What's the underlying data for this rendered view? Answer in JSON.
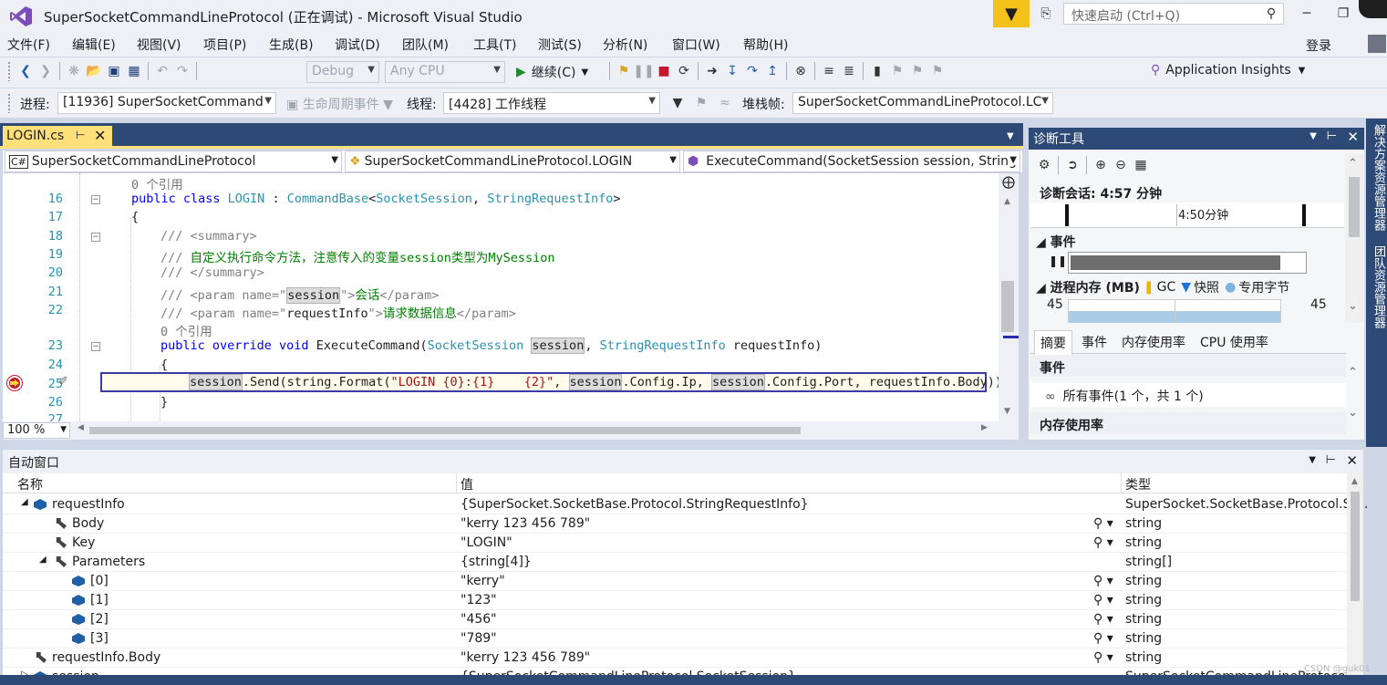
{
  "window": {
    "title": "SuperSocketCommandLineProtocol (正在调试) - Microsoft Visual Studio",
    "quick_launch_placeholder": "快速启动 (Ctrl+Q)",
    "login": "登录"
  },
  "menu": [
    "文件(F)",
    "编辑(E)",
    "视图(V)",
    "项目(P)",
    "生成(B)",
    "调试(D)",
    "团队(M)",
    "工具(T)",
    "测试(S)",
    "分析(N)",
    "窗口(W)",
    "帮助(H)"
  ],
  "toolbar1": {
    "config": "Debug",
    "platform": "Any CPU",
    "continue": "继续(C)",
    "app_insights": "Application Insights"
  },
  "toolbar2": {
    "process_label": "进程:",
    "process": "[11936] SuperSocketCommand",
    "lifecycle": "生命周期事件",
    "thread_label": "线程:",
    "thread": "[4428] 工作线程",
    "stack_label": "堆栈帧:",
    "stack": "SuperSocketCommandLineProtocol.LC"
  },
  "editor": {
    "tab": "LOGIN.cs",
    "nav": [
      "SuperSocketCommandLineProtocol",
      "SuperSocketCommandLineProtocol.LOGIN",
      "ExecuteCommand(SocketSession session, String"
    ],
    "zoom": "100 %",
    "refs1": "0 个引用",
    "refs2": "0 个引用",
    "line_numbers": [
      "16",
      "17",
      "18",
      "19",
      "20",
      "21",
      "22",
      "23",
      "24",
      "25",
      "26",
      "27"
    ],
    "l16": {
      "a": "public class ",
      "b": "LOGIN",
      "c": " : ",
      "d": "CommandBase",
      "e": "<",
      "f": "SocketSession",
      "g": ", ",
      "h": "StringRequestInfo",
      "i": ">"
    },
    "l17": "{",
    "l18": {
      "a": "/// ",
      "b": "<summary>"
    },
    "l19": {
      "a": "/// ",
      "b": "自定义执行命令方法，注意传入的变量session类型为MySession"
    },
    "l20": {
      "a": "/// ",
      "b": "</summary>"
    },
    "l21": {
      "a": "/// ",
      "b": "<param name=\"",
      "c": "session",
      "d": "\">",
      "e": "会话",
      "f": "</param>"
    },
    "l22": {
      "a": "/// ",
      "b": "<param name=\"",
      "c": "requestInfo",
      "d": "\">",
      "e": "请求数据信息",
      "f": "</param>"
    },
    "l23": {
      "a": "public override void ",
      "b": "ExecuteCommand(",
      "c": "SocketSession",
      "d": " ",
      "e": "session",
      "f": ", ",
      "g": "StringRequestInfo",
      "h": " requestInfo)"
    },
    "l24": "{",
    "l25": {
      "a": "session",
      "b": ".Send(string.Format(",
      "c": "\"LOGIN {0}:{1}    {2}\"",
      "d": ", ",
      "e": "session",
      "f": ".Config.Ip, ",
      "g": "session",
      "h": ".Config.Port, requestInfo.Body));"
    },
    "l26": "}"
  },
  "diagnostics": {
    "title": "诊断工具",
    "session": "诊断会话: 4:57 分钟",
    "timeline_label": "4:50分钟",
    "events_label": "事件",
    "memory_label": "进程内存 (MB)",
    "gc": "GC",
    "snapshot": "快照",
    "private_bytes": "专用字节",
    "mem_left": "45",
    "mem_right": "45",
    "tabs": [
      "摘要",
      "事件",
      "内存使用率",
      "CPU 使用率"
    ],
    "events_section": "事件",
    "all_events": "所有事件(1 个，共 1 个)",
    "memory_section": "内存使用率"
  },
  "right_strip": {
    "solution_explorer": "解决方案资源管理器",
    "team_explorer": "团队资源管理器"
  },
  "autos": {
    "title": "自动窗口",
    "columns": {
      "name": "名称",
      "value": "值",
      "type": "类型"
    },
    "rows": [
      {
        "name": "requestInfo",
        "value": "{SuperSocket.SocketBase.Protocol.StringRequestInfo}",
        "type": "SuperSocket.SocketBase.Protocol.St..."
      },
      {
        "name": "Body",
        "value": "\"kerry 123 456 789\"",
        "type": "string"
      },
      {
        "name": "Key",
        "value": "\"LOGIN\"",
        "type": "string"
      },
      {
        "name": "Parameters",
        "value": "{string[4]}",
        "type": "string[]"
      },
      {
        "name": "[0]",
        "value": "\"kerry\"",
        "type": "string"
      },
      {
        "name": "[1]",
        "value": "\"123\"",
        "type": "string"
      },
      {
        "name": "[2]",
        "value": "\"456\"",
        "type": "string"
      },
      {
        "name": "[3]",
        "value": "\"789\"",
        "type": "string"
      },
      {
        "name": "requestInfo.Body",
        "value": "\"kerry 123 456 789\"",
        "type": "string"
      },
      {
        "name": "session",
        "value": "{SuperSocketCommandLineProtocol.SocketSession}",
        "type": "SuperSocketCommandLineProtocol..."
      }
    ]
  },
  "watermark": "CSDN @guk01"
}
